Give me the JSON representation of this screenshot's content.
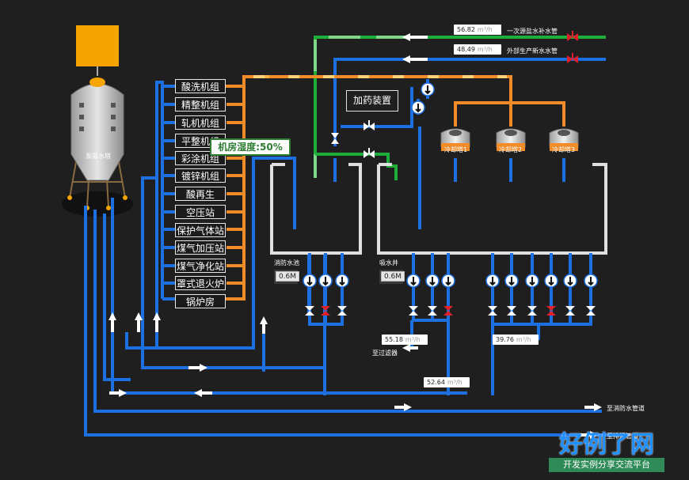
{
  "tower": {
    "label": "泵吸水塔"
  },
  "units": [
    "酸洗机组",
    "精整机组",
    "轧机机组",
    "平整机组",
    "彩涂机组",
    "镀锌机组",
    "酸再生",
    "空压站",
    "保护气体站",
    "煤气加压站",
    "煤气净化站",
    "罩式退火炉",
    "锅炉房"
  ],
  "humidity": {
    "label": "机房湿度:50%"
  },
  "dosing": {
    "label": "加药装置"
  },
  "coolers": [
    "冷却塔1",
    "冷却塔2",
    "冷却塔3"
  ],
  "pools": {
    "left_label": "消防水池",
    "right_label": "吸水井",
    "left_level": "0.6M",
    "right_level": "0.6M"
  },
  "flows": {
    "top1": {
      "value": "56.82",
      "unit": "m³/h",
      "label": "一次源盐水补水管"
    },
    "top2": {
      "value": "48.49",
      "unit": "m³/h",
      "label": "外部生产新水水管"
    },
    "filter": {
      "value": "55.18",
      "unit": "m³/h",
      "label": "至过滤器"
    },
    "right": {
      "value": "39.76",
      "unit": "m³/h"
    },
    "mid": {
      "value": "52.64",
      "unit": "m³/h"
    }
  },
  "outlets": {
    "fire": "至消防水管道",
    "waste": "至排污管道"
  },
  "brand": {
    "title": "好例了网",
    "subtitle": "开发实例分享交流平台"
  },
  "colors": {
    "pipe_blue": "#1e6fe0",
    "pipe_orange": "#f28c28",
    "pipe_green": "#1fae3a",
    "valve_red": "#e0202a",
    "tower_orange": "#f5a400"
  }
}
